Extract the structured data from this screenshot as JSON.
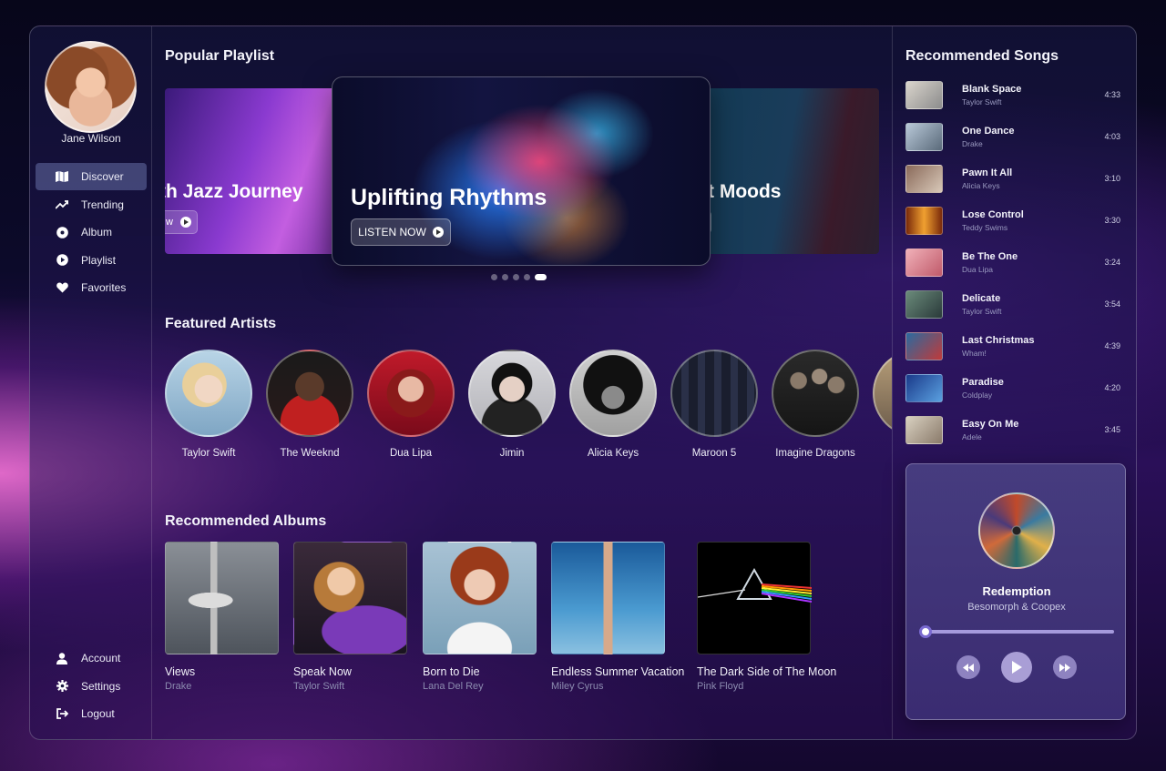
{
  "user": {
    "name": "Jane Wilson"
  },
  "nav": {
    "items": [
      {
        "label": "Discover",
        "icon": "map-icon"
      },
      {
        "label": "Trending",
        "icon": "trending-icon"
      },
      {
        "label": "Album",
        "icon": "disc-icon"
      },
      {
        "label": "Playlist",
        "icon": "play-circle-icon"
      },
      {
        "label": "Favorites",
        "icon": "heart-icon"
      }
    ],
    "bottom": [
      {
        "label": "Account",
        "icon": "user-icon"
      },
      {
        "label": "Settings",
        "icon": "gear-icon"
      },
      {
        "label": "Logout",
        "icon": "logout-icon"
      }
    ]
  },
  "playlist": {
    "title": "Popular Playlist",
    "left_title": "Smooth Jazz Journey",
    "left_title_visible": "th Jazz Journey",
    "left_button_visible": "w",
    "center_title": "Uplifting Rhythms",
    "center_button": "LISTEN NOW",
    "right_title_visible": "t Moods",
    "active_dot": 5
  },
  "artists": {
    "title": "Featured Artists",
    "items": [
      "Taylor Swift",
      "The Weeknd",
      "Dua Lipa",
      "Jimin",
      "Alicia Keys",
      "Maroon 5",
      "Imagine Dragons"
    ]
  },
  "albums": {
    "title": "Recommended Albums",
    "items": [
      {
        "title": "Views",
        "artist": "Drake"
      },
      {
        "title": "Speak Now",
        "artist": "Taylor Swift"
      },
      {
        "title": "Born to Die",
        "artist": "Lana Del Rey"
      },
      {
        "title": "Endless Summer Vacation",
        "artist": "Miley Cyrus"
      },
      {
        "title": "The Dark Side of The Moon",
        "artist": "Pink Floyd"
      }
    ]
  },
  "songs": {
    "title": "Recommended Songs",
    "items": [
      {
        "title": "Blank Space",
        "artist": "Taylor Swift",
        "duration": "4:33"
      },
      {
        "title": "One Dance",
        "artist": "Drake",
        "duration": "4:03"
      },
      {
        "title": "Pawn It All",
        "artist": "Alicia Keys",
        "duration": "3:10"
      },
      {
        "title": "Lose Control",
        "artist": "Teddy Swims",
        "duration": "3:30"
      },
      {
        "title": "Be The One",
        "artist": "Dua Lipa",
        "duration": "3:24"
      },
      {
        "title": "Delicate",
        "artist": "Taylor Swift",
        "duration": "3:54"
      },
      {
        "title": "Last Christmas",
        "artist": "Wham!",
        "duration": "4:39"
      },
      {
        "title": "Paradise",
        "artist": "Coldplay",
        "duration": "4:20"
      },
      {
        "title": "Easy On Me",
        "artist": "Adele",
        "duration": "3:45"
      }
    ]
  },
  "player": {
    "title": "Redemption",
    "artist": "Besomorph & Coopex",
    "progress": 0.0
  },
  "colors": {
    "accent": "#7a6ad0",
    "nav_active": "#5a6296"
  }
}
